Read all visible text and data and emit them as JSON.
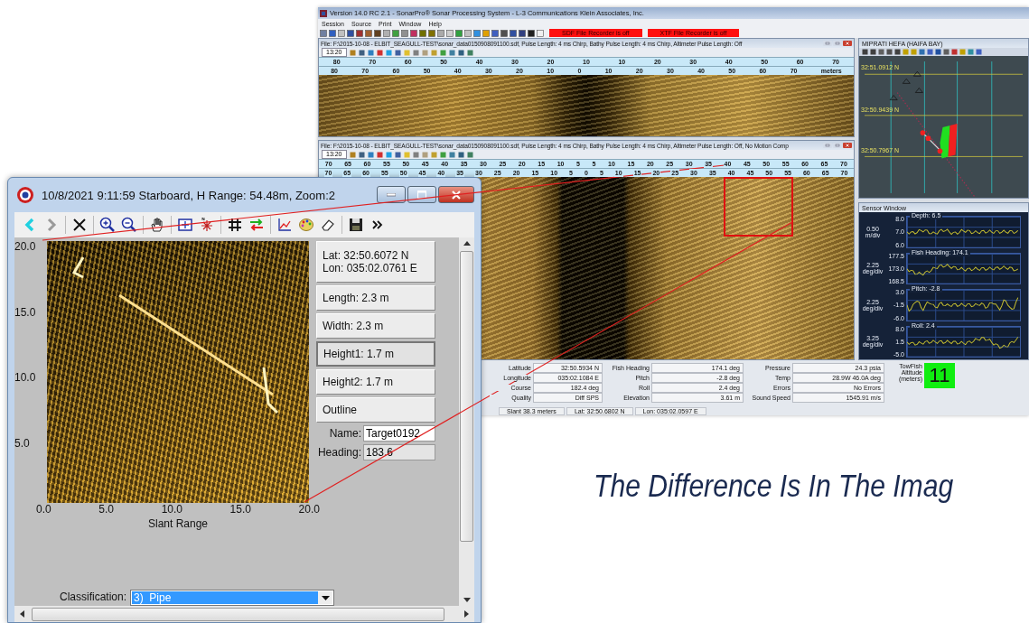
{
  "main_window": {
    "title": "Version 14.0 RC 2.1 - SonarPro® Sonar Processing System - L-3 Communications Klein Associates, Inc.",
    "menu": [
      "Session",
      "Source",
      "Print",
      "Window",
      "Help"
    ],
    "recorder_alerts": [
      "SDF File Recorder is off",
      "XTF File Recorder is off"
    ],
    "sonar_panes": [
      {
        "title": "File: F:\\2015-10-08 - ELBIT_SEAGULL-TEST\\sonar_data0150908091100.sdf, Pulse Length: 4 ms Chirp, Bathy Pulse Length: 4 ms Chirp, Altimeter Pulse Length: Off",
        "time": "13:20",
        "scale_rows": [
          [
            "80",
            "70",
            "60",
            "50",
            "40",
            "30",
            "20",
            "10",
            "10",
            "20",
            "30",
            "40",
            "50",
            "60",
            "70"
          ],
          [
            "80",
            "70",
            "60",
            "50",
            "40",
            "30",
            "20",
            "10",
            "0",
            "10",
            "20",
            "30",
            "40",
            "50",
            "60",
            "70",
            "meters"
          ]
        ],
        "highlight": false
      },
      {
        "title": "File: F:\\2015-10-08 - ELBIT_SEAGULL-TEST\\sonar_data0150908091100.sdf, Pulse Length: 4 ms Chirp, Bathy Pulse Length: 4 ms Chirp, Altimeter Pulse Length: Off, No Motion Comp",
        "time": "13:20",
        "scale_rows": [
          [
            "70",
            "65",
            "60",
            "55",
            "50",
            "45",
            "40",
            "35",
            "30",
            "25",
            "20",
            "15",
            "10",
            "5",
            "5",
            "10",
            "15",
            "20",
            "25",
            "30",
            "35",
            "40",
            "45",
            "50",
            "55",
            "60",
            "65",
            "70"
          ],
          [
            "70",
            "65",
            "60",
            "55",
            "50",
            "45",
            "40",
            "35",
            "30",
            "25",
            "20",
            "15",
            "10",
            "5",
            "0",
            "5",
            "10",
            "15",
            "20",
            "25",
            "30",
            "35",
            "40",
            "45",
            "50",
            "55",
            "60",
            "65",
            "70"
          ]
        ],
        "highlight": true
      }
    ],
    "status_fields": [
      {
        "label": "Latitude",
        "value": "32:50.5934 N"
      },
      {
        "label": "Longitude",
        "value": "035:02.1084 E"
      },
      {
        "label": "Course",
        "value": "182.4 deg"
      },
      {
        "label": "Quality",
        "value": "Diff SPS"
      },
      {
        "label": "Fish Heading",
        "value": "174.1 deg"
      },
      {
        "label": "Pitch",
        "value": "-2.8 deg"
      },
      {
        "label": "Roll",
        "value": "2.4 deg"
      },
      {
        "label": "Elevation",
        "value": "3.61 m"
      },
      {
        "label": "Pressure",
        "value": "24.3 psia"
      },
      {
        "label": "Temp",
        "value": "28.9W 46.0A deg"
      },
      {
        "label": "Errors",
        "value": "No Errors"
      },
      {
        "label": "Sound Speed",
        "value": "1545.91 m/s"
      }
    ],
    "towfish": {
      "label": "TowFish Altitude (meters)",
      "value": "11"
    },
    "status_bar": [
      "Slant 38.3 meters",
      "Lat: 32:50.6802 N",
      "Lon: 035:02.0597 E"
    ],
    "map_window": {
      "title": "MIPRATI HEFA (HAIFA BAY)",
      "lat_labels": [
        "32:51.0912 N",
        "32:50.9439 N",
        "32:50.7967 N"
      ]
    },
    "sensor_window": {
      "title": "Sensor Window",
      "plots": [
        {
          "label": "Depth: 6.5",
          "scale": "0.50 m/div",
          "ticks": [
            "8.0",
            "7.0",
            "6.0"
          ]
        },
        {
          "label": "Fish Heading: 174.1",
          "scale": "2.25 deg/div",
          "ticks": [
            "177.5",
            "173.0",
            "168.5"
          ]
        },
        {
          "label": "Pitch: -2.8",
          "scale": "2.25 deg/div",
          "ticks": [
            "3.0",
            "-1.5",
            "-6.0"
          ]
        },
        {
          "label": "Roll: 2.4",
          "scale": "3.25 deg/div",
          "ticks": [
            "8.0",
            "1.5",
            "-5.0"
          ]
        }
      ]
    }
  },
  "target_window": {
    "title": "10/8/2021 9:11:59 Starboard, H Range: 54.48m, Zoom:2",
    "y_ticks": [
      "20.0",
      "15.0",
      "10.0",
      "5.0"
    ],
    "x_ticks": [
      "0.0",
      "5.0",
      "10.0",
      "15.0",
      "20.0"
    ],
    "x_label": "Slant Range",
    "info_buttons": [
      {
        "kind": "coords",
        "lines": [
          "Lat:   32:50.6072 N",
          "Lon: 035:02.0761 E"
        ],
        "selected": false
      },
      {
        "kind": "single",
        "lines": [
          "Length:  2.3 m"
        ],
        "selected": false
      },
      {
        "kind": "single",
        "lines": [
          "Width:  2.3 m"
        ],
        "selected": false
      },
      {
        "kind": "single",
        "lines": [
          "Height1:  1.7 m"
        ],
        "selected": true
      },
      {
        "kind": "single",
        "lines": [
          "Height2:  1.7 m"
        ],
        "selected": false
      },
      {
        "kind": "single",
        "lines": [
          "Outline"
        ],
        "selected": false
      }
    ],
    "fields": [
      {
        "label": "Name:",
        "value": "Target0192",
        "disabled": false
      },
      {
        "label": "Heading:",
        "value": "183.6",
        "disabled": true
      }
    ],
    "classification": {
      "label": "Classification:",
      "value": "3)  Pipe"
    }
  },
  "tagline": "The Difference Is In The Imag"
}
